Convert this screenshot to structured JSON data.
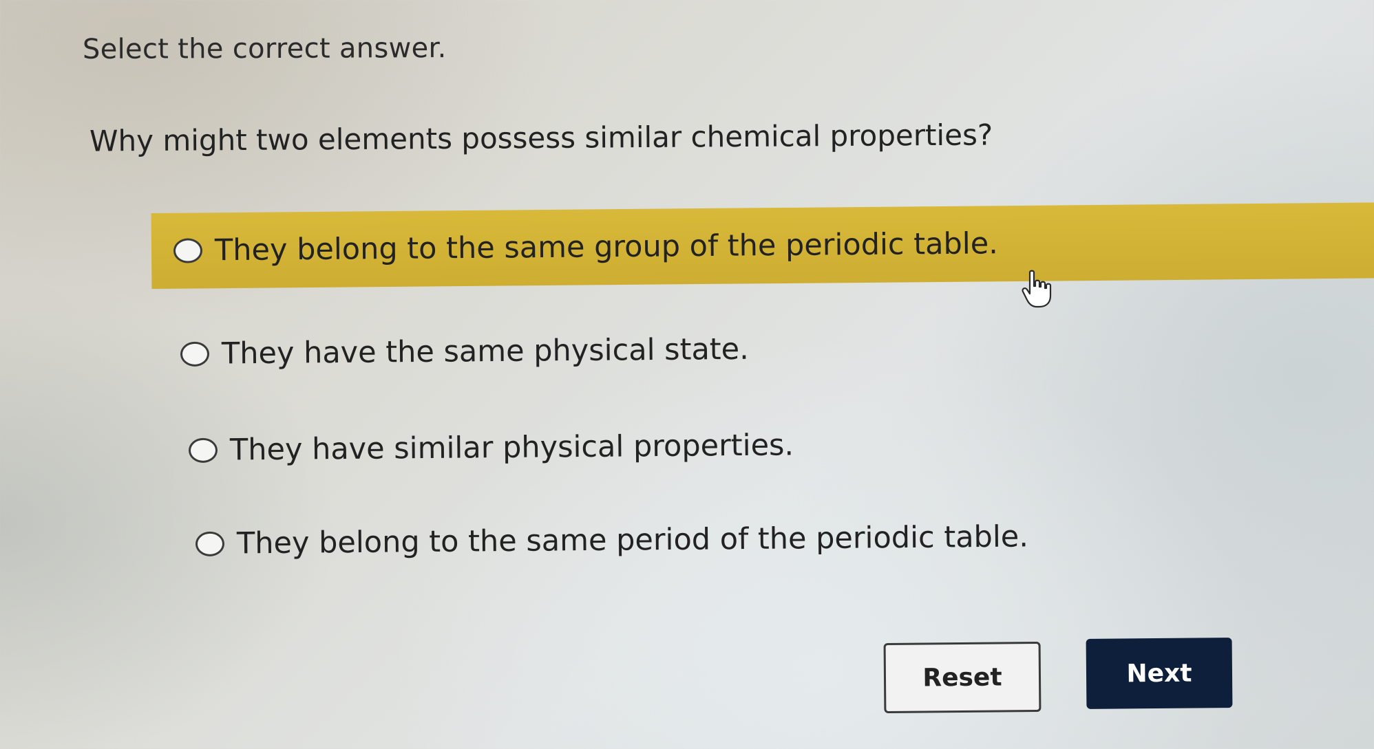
{
  "instruction": "Select the correct answer.",
  "question": "Why might two elements possess similar chemical properties?",
  "options": [
    {
      "label": "They belong to the same group of the periodic table.",
      "highlighted": true
    },
    {
      "label": "They have the same physical state.",
      "highlighted": false
    },
    {
      "label": "They have similar physical properties.",
      "highlighted": false
    },
    {
      "label": "They belong to the same period of the periodic table.",
      "highlighted": false
    }
  ],
  "buttons": {
    "reset_label": "Reset",
    "next_label": "Next"
  },
  "colors": {
    "highlight": "#d3b335",
    "next_button": "#0d1f3a"
  },
  "cursor_icon": "hand-pointer-icon"
}
